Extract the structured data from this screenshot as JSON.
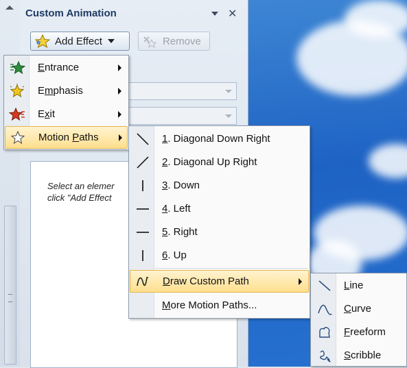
{
  "pane": {
    "title": "Custom Animation",
    "add_effect_label": "Add Effect",
    "remove_label": "Remove",
    "hint_line1": "Select an elemer",
    "hint_line2": "click \"Add Effect"
  },
  "add_effect_menu": [
    {
      "pre": "",
      "key": "E",
      "post": "ntrance",
      "icon": "entrance-star-icon",
      "color": "#2e8b3d"
    },
    {
      "pre": "E",
      "key": "m",
      "post": "phasis",
      "icon": "emphasis-star-icon",
      "color": "#e0b000"
    },
    {
      "pre": "E",
      "key": "x",
      "post": "it",
      "icon": "exit-star-icon",
      "color": "#d23a1f"
    },
    {
      "pre": "Motion ",
      "key": "P",
      "post": "aths",
      "icon": "motion-path-star-icon",
      "color": "#ffffff"
    }
  ],
  "motion_paths_menu": [
    {
      "pre": "",
      "key": "1",
      "post": ". Diagonal Down Right",
      "icon": "diagonal-down-right-icon"
    },
    {
      "pre": "",
      "key": "2",
      "post": ". Diagonal Up Right",
      "icon": "diagonal-up-right-icon"
    },
    {
      "pre": "",
      "key": "3",
      "post": ". Down",
      "icon": "down-line-icon"
    },
    {
      "pre": "",
      "key": "4",
      "post": ". Left",
      "icon": "left-line-icon"
    },
    {
      "pre": "",
      "key": "5",
      "post": ". Right",
      "icon": "right-line-icon"
    },
    {
      "pre": "",
      "key": "6",
      "post": ". Up",
      "icon": "up-line-icon"
    },
    {
      "pre": "",
      "key": "D",
      "post": "raw Custom Path",
      "icon": "custom-path-icon"
    },
    {
      "pre": "",
      "key": "M",
      "post": "ore Motion Paths...",
      "icon": ""
    }
  ],
  "custom_path_menu": [
    {
      "pre": "",
      "key": "L",
      "post": "ine",
      "icon": "line-tool-icon"
    },
    {
      "pre": "",
      "key": "C",
      "post": "urve",
      "icon": "curve-tool-icon"
    },
    {
      "pre": "",
      "key": "F",
      "post": "reeform",
      "icon": "freeform-tool-icon"
    },
    {
      "pre": "",
      "key": "S",
      "post": "cribble",
      "icon": "scribble-tool-icon"
    }
  ]
}
